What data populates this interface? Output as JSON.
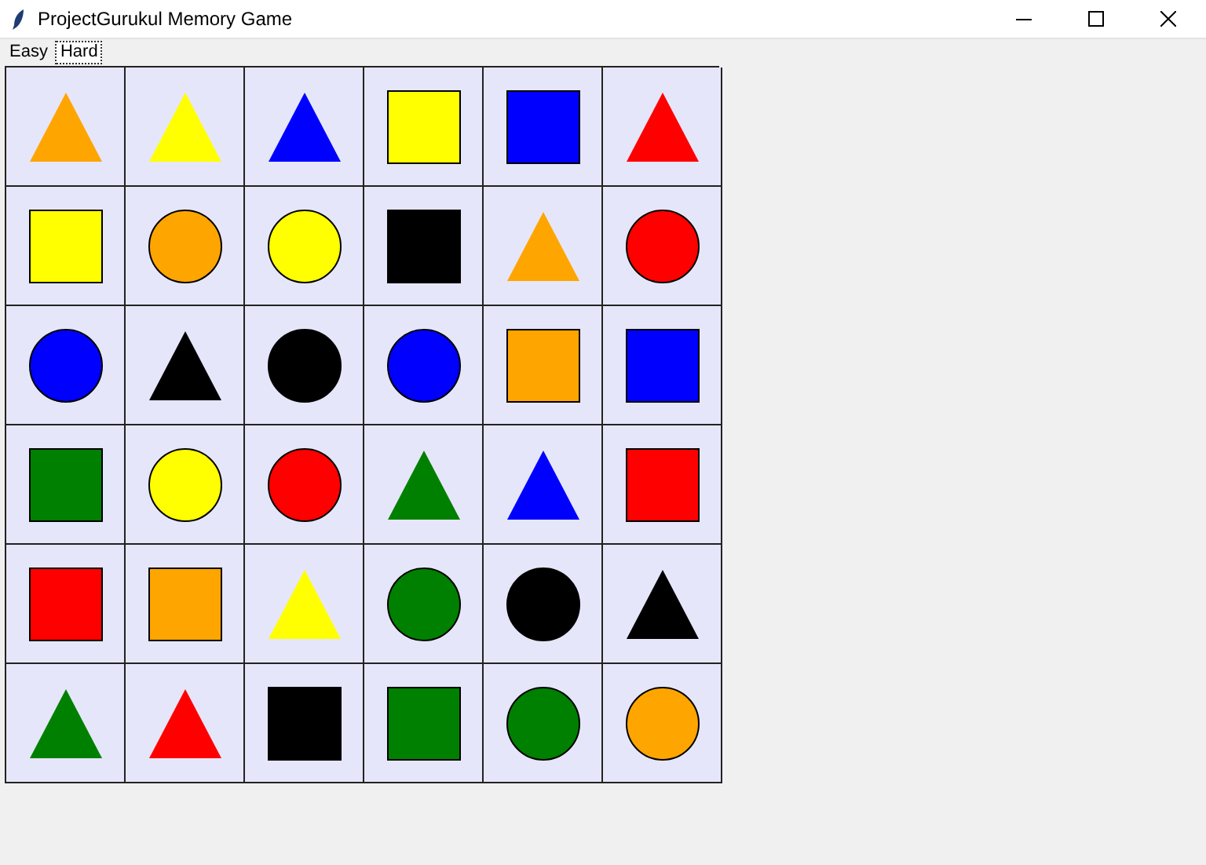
{
  "window": {
    "title": "ProjectGurukul Memory Game"
  },
  "tabs": [
    {
      "label": "Easy",
      "selected": false
    },
    {
      "label": "Hard",
      "selected": true
    }
  ],
  "board": {
    "rows": [
      [
        {
          "kind": "triangle",
          "color": "#ffa500"
        },
        {
          "kind": "triangle",
          "color": "#ffff00"
        },
        {
          "kind": "triangle",
          "color": "#0000ff"
        },
        {
          "kind": "square",
          "color": "#ffff00"
        },
        {
          "kind": "square",
          "color": "#0000ff"
        },
        {
          "kind": "triangle",
          "color": "#ff0000"
        }
      ],
      [
        {
          "kind": "square",
          "color": "#ffff00"
        },
        {
          "kind": "circle",
          "color": "#ffa500"
        },
        {
          "kind": "circle",
          "color": "#ffff00"
        },
        {
          "kind": "square",
          "color": "#000000"
        },
        {
          "kind": "triangle",
          "color": "#ffa500"
        },
        {
          "kind": "circle",
          "color": "#ff0000"
        }
      ],
      [
        {
          "kind": "circle",
          "color": "#0000ff"
        },
        {
          "kind": "triangle",
          "color": "#000000"
        },
        {
          "kind": "circle",
          "color": "#000000"
        },
        {
          "kind": "circle",
          "color": "#0000ff"
        },
        {
          "kind": "square",
          "color": "#ffa500"
        },
        {
          "kind": "square",
          "color": "#0000ff"
        }
      ],
      [
        {
          "kind": "square",
          "color": "#008000"
        },
        {
          "kind": "circle",
          "color": "#ffff00"
        },
        {
          "kind": "circle",
          "color": "#ff0000"
        },
        {
          "kind": "triangle",
          "color": "#008000"
        },
        {
          "kind": "triangle",
          "color": "#0000ff"
        },
        {
          "kind": "square",
          "color": "#ff0000"
        }
      ],
      [
        {
          "kind": "square",
          "color": "#ff0000"
        },
        {
          "kind": "square",
          "color": "#ffa500"
        },
        {
          "kind": "triangle",
          "color": "#ffff00"
        },
        {
          "kind": "circle",
          "color": "#008000"
        },
        {
          "kind": "circle",
          "color": "#000000"
        },
        {
          "kind": "triangle",
          "color": "#000000"
        }
      ],
      [
        {
          "kind": "triangle",
          "color": "#008000"
        },
        {
          "kind": "triangle",
          "color": "#ff0000"
        },
        {
          "kind": "square",
          "color": "#000000"
        },
        {
          "kind": "square",
          "color": "#008000"
        },
        {
          "kind": "circle",
          "color": "#008000"
        },
        {
          "kind": "circle",
          "color": "#ffa500"
        }
      ]
    ]
  }
}
